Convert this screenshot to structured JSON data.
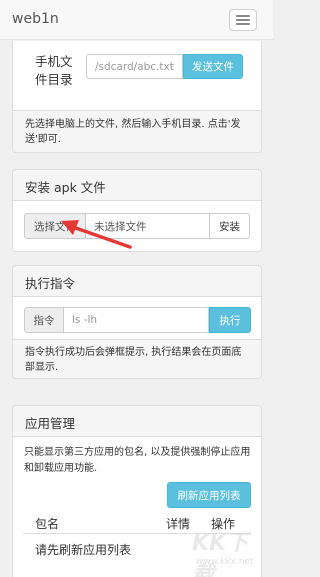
{
  "navbar": {
    "brand": "web1n"
  },
  "send_panel": {
    "label": "手机文件目录",
    "path_value": "/sdcard/abc.txt",
    "send_button": "发送文件",
    "footer": "先选择电脑上的文件, 然后输入手机目录. 点击'发送'即可."
  },
  "apk_panel": {
    "title": "安装 apk 文件",
    "choose_button": "选择文件",
    "no_file_text": "未选择文件",
    "install_button": "安装"
  },
  "cmd_panel": {
    "title": "执行指令",
    "addon_label": "指令",
    "placeholder": "ls -lh",
    "exec_button": "执行",
    "footer": "指令执行成功后会弹框提示, 执行结果会在页面底部显示."
  },
  "app_panel": {
    "title": "应用管理",
    "description": "只能显示第三方应用的包名, 以及提供强制停止应用和卸载应用功能.",
    "refresh_button": "刷新应用列表",
    "columns": [
      "包名",
      "详情",
      "操作"
    ],
    "empty_text": "请先刷新应用列表"
  },
  "watermark": {
    "text": "KK下载",
    "url": "www.kkx.net"
  },
  "colors": {
    "accent": "#5bc0de",
    "arrow": "#e53935"
  }
}
